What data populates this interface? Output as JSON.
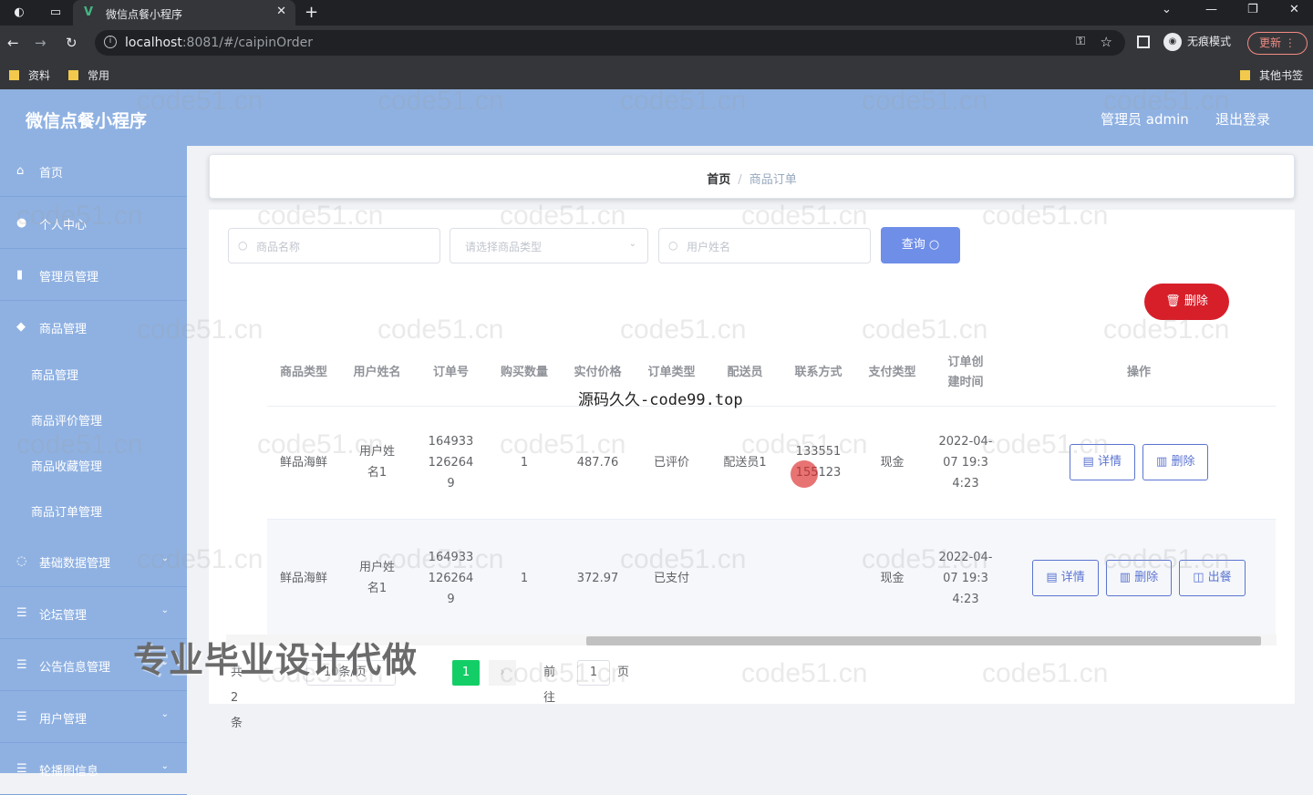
{
  "browser": {
    "tab_title": "微信点餐小程序",
    "url_host": "localhost",
    "url_rest": ":8081/#/caipinOrder",
    "incognito_label": "无痕模式",
    "update_label": "更新",
    "bookmarks": [
      "资料",
      "常用"
    ],
    "other_bookmarks": "其他书签"
  },
  "app": {
    "brand": "微信点餐小程序",
    "admin_label": "管理员 admin",
    "logout_label": "退出登录"
  },
  "sidebar": {
    "items": [
      {
        "label": "首页",
        "icon": "home-icon"
      },
      {
        "label": "个人中心",
        "icon": "user-icon"
      },
      {
        "label": "管理员管理",
        "icon": "chart-icon"
      },
      {
        "label": "商品管理",
        "icon": "shop-icon"
      }
    ],
    "subitems": [
      "商品管理",
      "商品评价管理",
      "商品收藏管理",
      "商品订单管理"
    ],
    "items2": [
      {
        "label": "基础数据管理",
        "icon": "data-icon"
      },
      {
        "label": "论坛管理",
        "icon": "forum-icon"
      },
      {
        "label": "公告信息管理",
        "icon": "notice-icon"
      },
      {
        "label": "用户管理",
        "icon": "users-icon"
      },
      {
        "label": "轮播图信息",
        "icon": "image-icon"
      }
    ]
  },
  "breadcrumb": {
    "home": "首页",
    "sep": "/",
    "current": "商品订单"
  },
  "search": {
    "name_placeholder": "商品名称",
    "type_placeholder": "请选择商品类型",
    "user_placeholder": "用户姓名",
    "query_label": "查询",
    "delete_label": "删除"
  },
  "table": {
    "headers": [
      "商品类型",
      "用户姓名",
      "订单号",
      "购买数量",
      "实付价格",
      "订单类型",
      "配送员",
      "联系方式",
      "支付类型",
      "订单创建时间",
      "操作"
    ],
    "rows": [
      {
        "type": "鲜品海鲜",
        "user": "用户姓名1",
        "order_no": "1649331262649",
        "qty": "1",
        "price": "487.76",
        "status": "已评价",
        "courier": "配送员1",
        "phone": "133551155123",
        "pay": "现金",
        "time": "2022-04-07 19:34:23",
        "actions": [
          "详情",
          "删除"
        ]
      },
      {
        "type": "鲜品海鲜",
        "user": "用户姓名1",
        "order_no": "1649331262649",
        "qty": "1",
        "price": "372.97",
        "status": "已支付",
        "courier": "",
        "phone": "",
        "pay": "现金",
        "time": "2022-04-07 19:34:23",
        "actions": [
          "详情",
          "删除",
          "出餐"
        ]
      }
    ]
  },
  "pagination": {
    "total": "共 2 条",
    "page_size": "10条/页",
    "current": "1",
    "goto_label": "前往",
    "goto_value": "1",
    "page_label": "页"
  },
  "overlays": {
    "watermark": "code51.cn",
    "source_text": "源码久久-code99.top",
    "promo_text": "专业毕业设计代做"
  }
}
